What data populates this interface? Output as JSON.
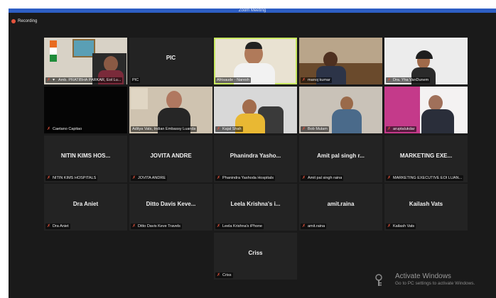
{
  "window": {
    "title": "Zoom Meeting"
  },
  "recording": {
    "label": "Recording"
  },
  "tiles": [
    {
      "big": "",
      "label": "Amb. PRATIBHA PARKAR, EoI Lu..."
    },
    {
      "big": "PIC",
      "label": "PIC"
    },
    {
      "big": "",
      "label": "Afrisaude - Naresh"
    },
    {
      "big": "",
      "label": "manoj kumar"
    },
    {
      "big": "",
      "label": "Dra. Yha VanDunem"
    },
    {
      "big": "",
      "label": "Caetano Capitao"
    },
    {
      "big": "",
      "label": "Aditya Vats, Indian Embassy Luanda"
    },
    {
      "big": "",
      "label": "Kajal Shah"
    },
    {
      "big": "",
      "label": "Bob Mulam"
    },
    {
      "big": "",
      "label": "aruptalukdar"
    },
    {
      "big": "NITIN KIMS HOS...",
      "label": "NITIN KIMS HOSPITALS"
    },
    {
      "big": "JOVITA ANDRE",
      "label": "JOVITA ANDRE"
    },
    {
      "big": "Phanindra  Yasho...",
      "label": "Phanindra Yashoda Hospitals"
    },
    {
      "big": "Amit pal singh r...",
      "label": "Amit pal singh raina"
    },
    {
      "big": "MARKETING  EXE...",
      "label": "MARKETING EXECUTIVE EOI LUAN..."
    },
    {
      "big": "Dra Aniet",
      "label": "Dra Aniet"
    },
    {
      "big": "Ditto Davis Keve...",
      "label": "Ditto Davis Keve Travels"
    },
    {
      "big": "Leela Krishna's i...",
      "label": "Leela Krishna's iPhone"
    },
    {
      "big": "amit.raina",
      "label": "amit.raina"
    },
    {
      "big": "Kailash Vats",
      "label": "Kailash Vats"
    },
    {
      "big": "Criss",
      "label": "Criss"
    }
  ],
  "watermark": {
    "title": "Activate Windows",
    "subtitle": "Go to PC settings to activate Windows."
  }
}
